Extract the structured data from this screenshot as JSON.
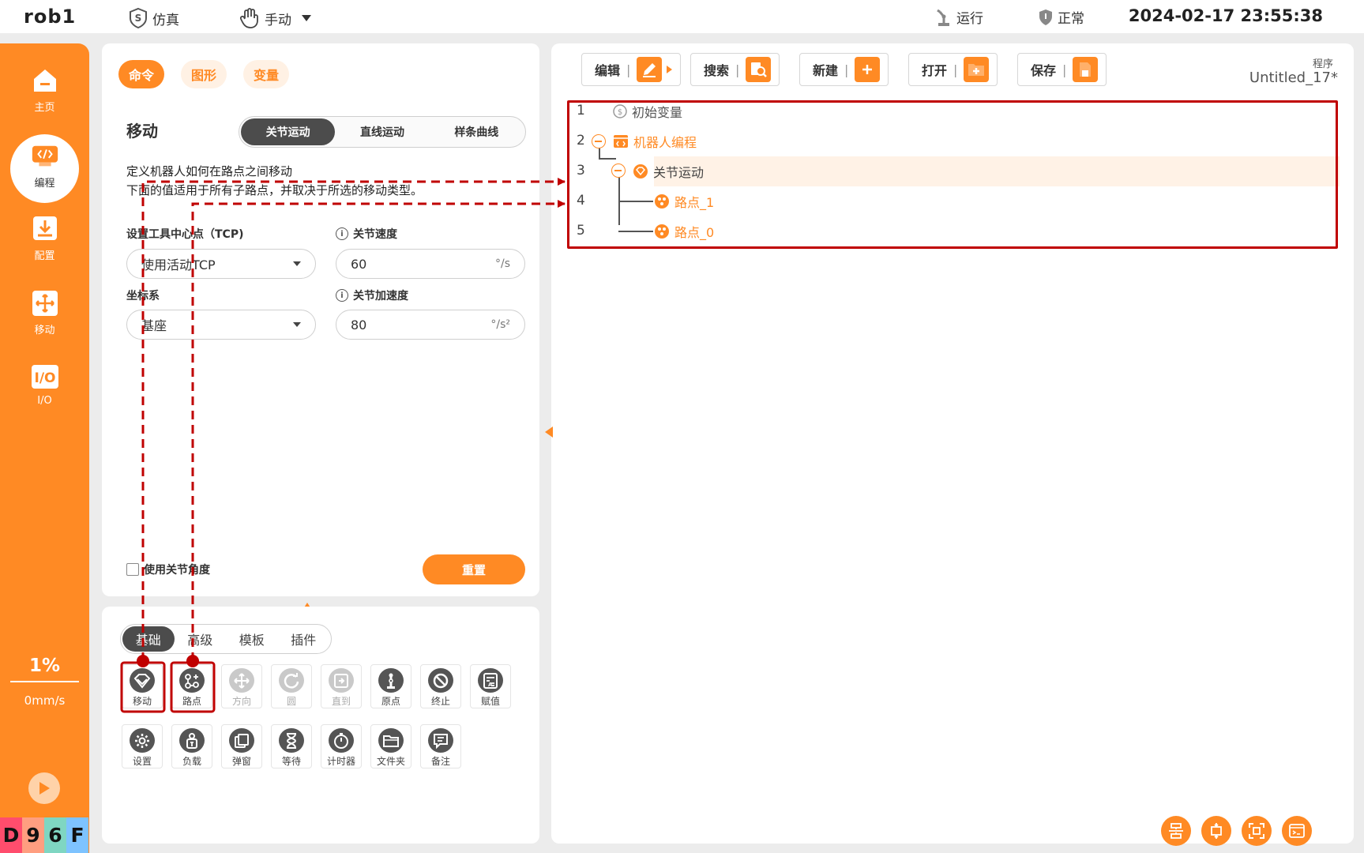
{
  "topbar": {
    "robot_name": "rob1",
    "mode_sim": "仿真",
    "mode_manual": "手动",
    "status_run": "运行",
    "status_state": "正常",
    "datetime": "2024-02-17 23:55:38"
  },
  "sidebar": {
    "items": [
      {
        "label": "主页",
        "icon": "home-icon"
      },
      {
        "label": "编程",
        "icon": "code-icon"
      },
      {
        "label": "配置",
        "icon": "download-icon"
      },
      {
        "label": "移动",
        "icon": "move-icon"
      },
      {
        "label": "I/O",
        "icon": "io-icon"
      }
    ],
    "speed_percent": "1%",
    "speed_mm": "0mm/s",
    "badge": [
      "D",
      "9",
      "6",
      "F"
    ],
    "badge_colors": [
      "#ff4d6d",
      "#ff9e80",
      "#7fd6c2",
      "#7ec3ff"
    ]
  },
  "command_panel": {
    "tabs": [
      "命令",
      "图形",
      "变量"
    ],
    "section_title": "移动",
    "move_types": [
      "关节运动",
      "直线运动",
      "样条曲线"
    ],
    "desc_line1": "定义机器人如何在路点之间移动",
    "desc_line2": "下面的值适用于所有子路点，并取决于所选的移动类型。",
    "tcp_label": "设置工具中心点（TCP)",
    "tcp_value": "使用活动TCP",
    "frame_label": "坐标系",
    "frame_value": "基座",
    "joint_speed_label": "关节速度",
    "joint_speed_value": "60",
    "joint_speed_unit": "°/s",
    "joint_accel_label": "关节加速度",
    "joint_accel_value": "80",
    "joint_accel_unit": "°/s²",
    "use_joint_angle": "使用关节角度",
    "reset_label": "重置"
  },
  "library": {
    "tabs": [
      "基础",
      "高级",
      "模板",
      "插件"
    ],
    "row1": [
      "移动",
      "路点",
      "方向",
      "圆",
      "直到",
      "原点",
      "终止",
      "赋值"
    ],
    "row2": [
      "设置",
      "负载",
      "弹窗",
      "等待",
      "计时器",
      "文件夹",
      "备注"
    ]
  },
  "program": {
    "toolbar": [
      "编辑",
      "搜索",
      "新建",
      "打开",
      "保存"
    ],
    "label": "程序",
    "name": "Untitled_17*",
    "lines": [
      "1",
      "2",
      "3",
      "4",
      "5"
    ],
    "nodes": [
      "初始变量",
      "机器人编程",
      "关节运动",
      "路点_1",
      "路点_0"
    ]
  },
  "colors": {
    "accent": "#ff8a24",
    "annotation": "#c00000"
  }
}
